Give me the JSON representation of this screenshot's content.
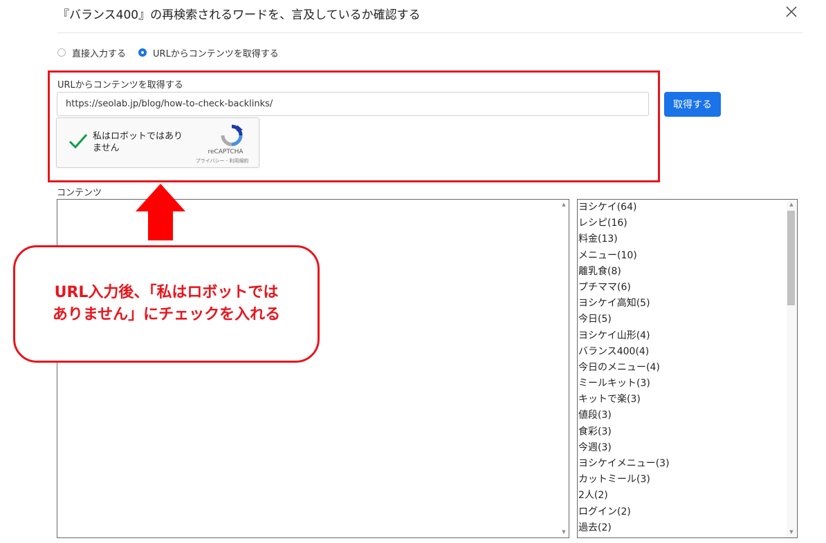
{
  "dialog": {
    "title": "『バランス400』の再検索されるワードを、言及しているか確認する"
  },
  "input_mode": {
    "options": [
      {
        "label": "直接入力する",
        "selected": false
      },
      {
        "label": "URLからコンテンツを取得する",
        "selected": true
      }
    ]
  },
  "url_section": {
    "label": "URLからコンテンツを取得する",
    "value": "https://seolab.jp/blog/how-to-check-backlinks/",
    "fetch_button": "取得する"
  },
  "recaptcha": {
    "label_line1": "私はロボットではあり",
    "label_line2": "ません",
    "brand": "reCAPTCHA",
    "links": "プライバシー - 利用規約",
    "checked": true
  },
  "content": {
    "label": "コンテンツ",
    "text": ""
  },
  "keyword_list": [
    "ヨシケイ(64)",
    "レシピ(16)",
    "料金(13)",
    "メニュー(10)",
    "離乳食(8)",
    "プチママ(6)",
    "ヨシケイ高知(5)",
    "今日(5)",
    "ヨシケイ山形(4)",
    "バランス400(4)",
    "今日のメニュー(4)",
    "ミールキット(3)",
    "キットで楽(3)",
    "値段(3)",
    "食彩(3)",
    "今週(3)",
    "ヨシケイメニュー(3)",
    "カットミール(3)",
    "2人(2)",
    "ログイン(2)",
    "過去(2)"
  ],
  "annotation": {
    "line1": "URL入力後、「私はロボットでは",
    "line2": "ありません」にチェックを入れる"
  },
  "colors": {
    "accent": "#1a73e8",
    "annotation_red": "#e8141c",
    "check_green": "#0a9e45"
  }
}
